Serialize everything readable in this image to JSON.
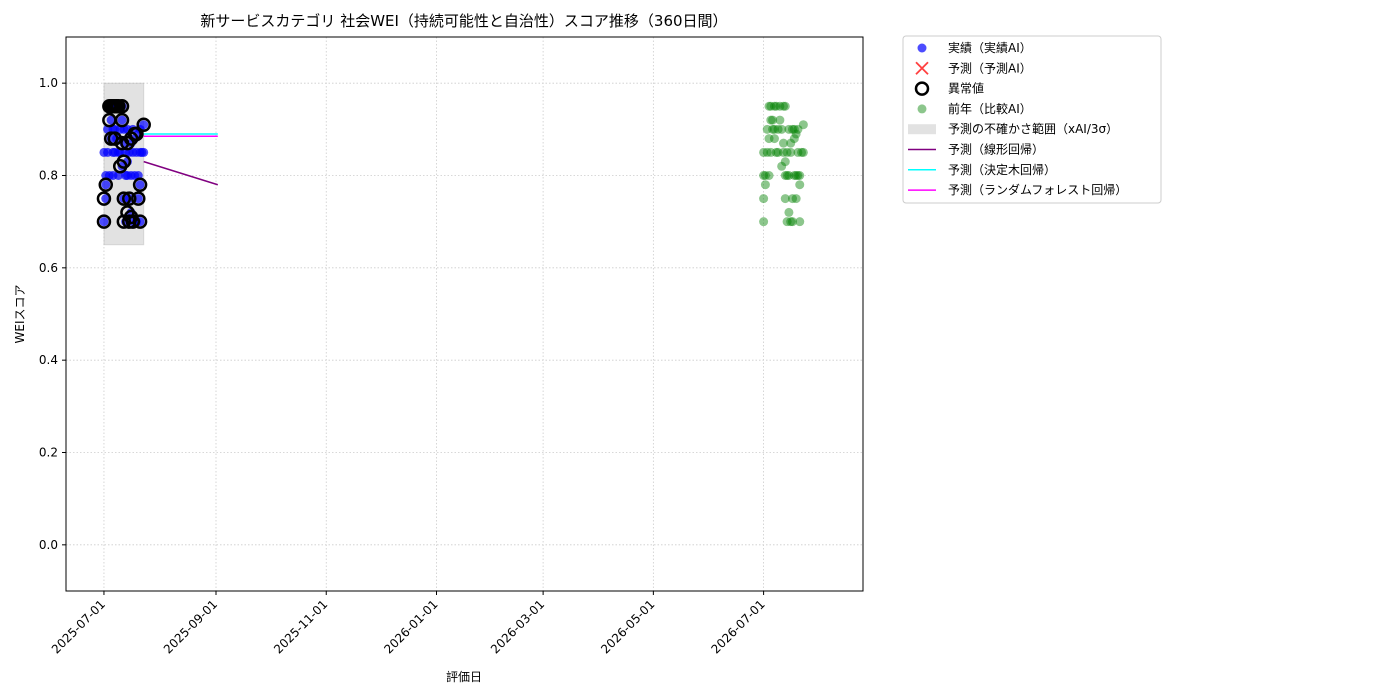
{
  "chart_data": {
    "type": "scatter",
    "title": "新サービスカテゴリ 社会WEI（持続可能性と自治性）スコア推移（360日間）",
    "xlabel": "評価日",
    "ylabel": "WEIスコア",
    "xlim": [
      "2025-06-10",
      "2026-08-25"
    ],
    "ylim": [
      -0.1,
      1.1
    ],
    "x_ticks": [
      "2025-07-01",
      "2025-09-01",
      "2025-11-01",
      "2026-01-01",
      "2026-03-01",
      "2026-05-01",
      "2026-07-01"
    ],
    "y_ticks": [
      0.0,
      0.2,
      0.4,
      0.6,
      0.8,
      1.0
    ],
    "grid": true,
    "legend_position": "outside-top-right",
    "series": [
      {
        "name": "実績（実績AI）",
        "kind": "scatter",
        "color": "#0000ff",
        "points": [
          [
            "2025-07-01",
            0.85
          ],
          [
            "2025-07-01",
            0.7
          ],
          [
            "2025-07-02",
            0.8
          ],
          [
            "2025-07-02",
            0.75
          ],
          [
            "2025-07-02",
            0.78
          ],
          [
            "2025-07-03",
            0.9
          ],
          [
            "2025-07-03",
            0.85
          ],
          [
            "2025-07-04",
            0.95
          ],
          [
            "2025-07-04",
            0.8
          ],
          [
            "2025-07-05",
            0.92
          ],
          [
            "2025-07-05",
            0.88
          ],
          [
            "2025-07-05",
            0.95
          ],
          [
            "2025-07-06",
            0.85
          ],
          [
            "2025-07-06",
            0.9
          ],
          [
            "2025-07-06",
            0.8
          ],
          [
            "2025-07-07",
            0.95
          ],
          [
            "2025-07-07",
            0.9
          ],
          [
            "2025-07-07",
            0.85
          ],
          [
            "2025-07-08",
            0.88
          ],
          [
            "2025-07-08",
            0.95
          ],
          [
            "2025-07-09",
            0.85
          ],
          [
            "2025-07-09",
            0.8
          ],
          [
            "2025-07-09",
            0.95
          ],
          [
            "2025-07-10",
            0.9
          ],
          [
            "2025-07-10",
            0.85
          ],
          [
            "2025-07-11",
            0.82
          ],
          [
            "2025-07-11",
            0.92
          ],
          [
            "2025-07-11",
            0.95
          ],
          [
            "2025-07-12",
            0.87
          ],
          [
            "2025-07-12",
            0.9
          ],
          [
            "2025-07-12",
            0.75
          ],
          [
            "2025-07-13",
            0.8
          ],
          [
            "2025-07-13",
            0.85
          ],
          [
            "2025-07-13",
            0.7
          ],
          [
            "2025-07-14",
            0.83
          ],
          [
            "2025-07-14",
            0.9
          ],
          [
            "2025-07-14",
            0.8
          ],
          [
            "2025-07-15",
            0.75
          ],
          [
            "2025-07-15",
            0.85
          ],
          [
            "2025-07-16",
            0.72
          ],
          [
            "2025-07-16",
            0.8
          ],
          [
            "2025-07-16",
            0.87
          ],
          [
            "2025-07-17",
            0.7
          ],
          [
            "2025-07-17",
            0.85
          ],
          [
            "2025-07-17",
            0.9
          ],
          [
            "2025-07-18",
            0.88
          ],
          [
            "2025-07-18",
            0.8
          ],
          [
            "2025-07-19",
            0.85
          ],
          [
            "2025-07-19",
            0.7
          ],
          [
            "2025-07-20",
            0.89
          ],
          [
            "2025-07-20",
            0.75
          ],
          [
            "2025-07-20",
            0.8
          ],
          [
            "2025-07-21",
            0.85
          ],
          [
            "2025-07-21",
            0.9
          ],
          [
            "2025-07-21",
            0.78
          ],
          [
            "2025-07-21",
            0.7
          ],
          [
            "2025-07-22",
            0.85
          ],
          [
            "2025-07-23",
            0.91
          ],
          [
            "2025-07-23",
            0.85
          ]
        ]
      },
      {
        "name": "予測（予測AI）",
        "kind": "x-marker",
        "color": "#ff0000",
        "points": []
      },
      {
        "name": "異常値",
        "kind": "outlier-ring",
        "color": "#000000",
        "points": [
          [
            "2025-07-01",
            0.7
          ],
          [
            "2025-07-01",
            0.75
          ],
          [
            "2025-07-02",
            0.78
          ],
          [
            "2025-07-04",
            0.95
          ],
          [
            "2025-07-04",
            0.92
          ],
          [
            "2025-07-05",
            0.88
          ],
          [
            "2025-07-05",
            0.95
          ],
          [
            "2025-07-06",
            0.95
          ],
          [
            "2025-07-07",
            0.95
          ],
          [
            "2025-07-07",
            0.88
          ],
          [
            "2025-07-08",
            0.95
          ],
          [
            "2025-07-09",
            0.95
          ],
          [
            "2025-07-10",
            0.82
          ],
          [
            "2025-07-11",
            0.87
          ],
          [
            "2025-07-11",
            0.92
          ],
          [
            "2025-07-11",
            0.95
          ],
          [
            "2025-07-12",
            0.83
          ],
          [
            "2025-07-12",
            0.75
          ],
          [
            "2025-07-12",
            0.7
          ],
          [
            "2025-07-14",
            0.87
          ],
          [
            "2025-07-14",
            0.72
          ],
          [
            "2025-07-15",
            0.7
          ],
          [
            "2025-07-15",
            0.75
          ],
          [
            "2025-07-16",
            0.88
          ],
          [
            "2025-07-16",
            0.71
          ],
          [
            "2025-07-17",
            0.7
          ],
          [
            "2025-07-18",
            0.89
          ],
          [
            "2025-07-19",
            0.89
          ],
          [
            "2025-07-20",
            0.75
          ],
          [
            "2025-07-21",
            0.78
          ],
          [
            "2025-07-21",
            0.7
          ],
          [
            "2025-07-23",
            0.91
          ]
        ]
      },
      {
        "name": "前年（比較AI）",
        "kind": "scatter",
        "color": "#008000",
        "points": [
          [
            "2026-07-01",
            0.85
          ],
          [
            "2026-07-01",
            0.8
          ],
          [
            "2026-07-01",
            0.75
          ],
          [
            "2026-07-01",
            0.7
          ],
          [
            "2026-07-02",
            0.78
          ],
          [
            "2026-07-02",
            0.8
          ],
          [
            "2026-07-03",
            0.85
          ],
          [
            "2026-07-03",
            0.9
          ],
          [
            "2026-07-04",
            0.95
          ],
          [
            "2026-07-04",
            0.88
          ],
          [
            "2026-07-04",
            0.8
          ],
          [
            "2026-07-05",
            0.92
          ],
          [
            "2026-07-05",
            0.85
          ],
          [
            "2026-07-05",
            0.95
          ],
          [
            "2026-07-06",
            0.9
          ],
          [
            "2026-07-06",
            0.92
          ],
          [
            "2026-07-07",
            0.88
          ],
          [
            "2026-07-07",
            0.95
          ],
          [
            "2026-07-07",
            0.9
          ],
          [
            "2026-07-08",
            0.85
          ],
          [
            "2026-07-08",
            0.95
          ],
          [
            "2026-07-09",
            0.9
          ],
          [
            "2026-07-09",
            0.85
          ],
          [
            "2026-07-10",
            0.95
          ],
          [
            "2026-07-10",
            0.92
          ],
          [
            "2026-07-11",
            0.82
          ],
          [
            "2026-07-11",
            0.9
          ],
          [
            "2026-07-12",
            0.87
          ],
          [
            "2026-07-12",
            0.85
          ],
          [
            "2026-07-12",
            0.95
          ],
          [
            "2026-07-13",
            0.8
          ],
          [
            "2026-07-13",
            0.75
          ],
          [
            "2026-07-13",
            0.83
          ],
          [
            "2026-07-13",
            0.95
          ],
          [
            "2026-07-14",
            0.8
          ],
          [
            "2026-07-14",
            0.85
          ],
          [
            "2026-07-14",
            0.7
          ],
          [
            "2026-07-15",
            0.72
          ],
          [
            "2026-07-15",
            0.9
          ],
          [
            "2026-07-15",
            0.8
          ],
          [
            "2026-07-16",
            0.87
          ],
          [
            "2026-07-16",
            0.7
          ],
          [
            "2026-07-16",
            0.85
          ],
          [
            "2026-07-17",
            0.75
          ],
          [
            "2026-07-17",
            0.9
          ],
          [
            "2026-07-17",
            0.7
          ],
          [
            "2026-07-18",
            0.88
          ],
          [
            "2026-07-18",
            0.8
          ],
          [
            "2026-07-18",
            0.9
          ],
          [
            "2026-07-19",
            0.89
          ],
          [
            "2026-07-19",
            0.8
          ],
          [
            "2026-07-19",
            0.75
          ],
          [
            "2026-07-20",
            0.85
          ],
          [
            "2026-07-20",
            0.9
          ],
          [
            "2026-07-20",
            0.8
          ],
          [
            "2026-07-21",
            0.78
          ],
          [
            "2026-07-21",
            0.8
          ],
          [
            "2026-07-21",
            0.7
          ],
          [
            "2026-07-22",
            0.85
          ],
          [
            "2026-07-23",
            0.91
          ],
          [
            "2026-07-23",
            0.85
          ]
        ]
      },
      {
        "name": "予測の不確かさ範囲（xAI/3σ）",
        "kind": "band",
        "color": "#d3d3d3",
        "x_range": [
          "2025-07-01",
          "2025-07-23"
        ],
        "y_range": [
          0.65,
          1.0
        ]
      },
      {
        "name": "予測（線形回帰）",
        "kind": "line",
        "color": "#800080",
        "points": [
          [
            "2025-07-23",
            0.83
          ],
          [
            "2025-09-02",
            0.78
          ]
        ]
      },
      {
        "name": "予測（決定木回帰）",
        "kind": "line",
        "color": "#00ffff",
        "points": [
          [
            "2025-07-23",
            0.89
          ],
          [
            "2025-09-02",
            0.89
          ]
        ]
      },
      {
        "name": "予測（ランダムフォレスト回帰）",
        "kind": "line",
        "color": "#ff00ff",
        "points": [
          [
            "2025-07-23",
            0.885
          ],
          [
            "2025-09-02",
            0.885
          ]
        ]
      }
    ]
  }
}
